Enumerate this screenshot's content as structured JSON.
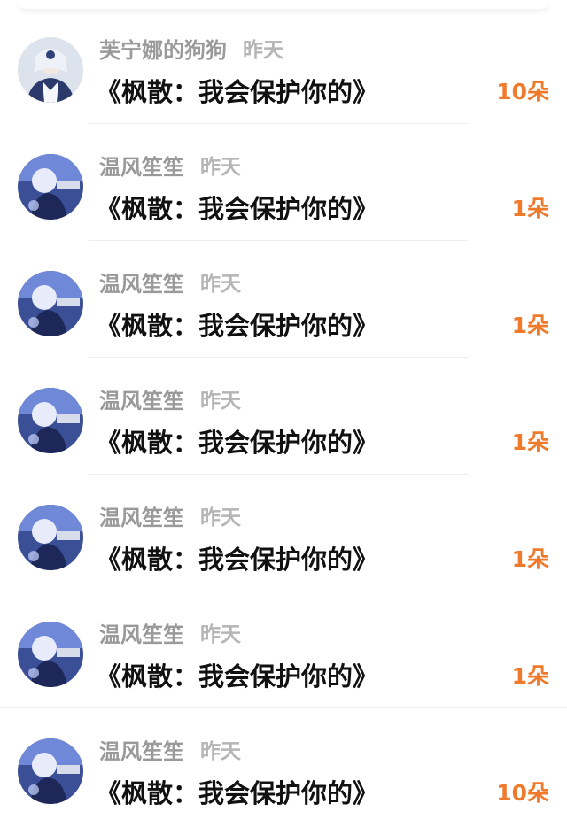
{
  "gifts": [
    {
      "username": "芙宁娜的狗狗",
      "time": "昨天",
      "gift": "《枫散：我会保护你的》",
      "count": "10朵",
      "avatar": "furina-avatar"
    },
    {
      "username": "温风笙笙",
      "time": "昨天",
      "gift": "《枫散：我会保护你的》",
      "count": "1朵",
      "avatar": "anime-avatar"
    },
    {
      "username": "温风笙笙",
      "time": "昨天",
      "gift": "《枫散：我会保护你的》",
      "count": "1朵",
      "avatar": "anime-avatar"
    },
    {
      "username": "温风笙笙",
      "time": "昨天",
      "gift": "《枫散：我会保护你的》",
      "count": "1朵",
      "avatar": "anime-avatar"
    },
    {
      "username": "温风笙笙",
      "time": "昨天",
      "gift": "《枫散：我会保护你的》",
      "count": "1朵",
      "avatar": "anime-avatar"
    },
    {
      "username": "温风笙笙",
      "time": "昨天",
      "gift": "《枫散：我会保护你的》",
      "count": "1朵",
      "avatar": "anime-avatar"
    },
    {
      "username": "温风笙笙",
      "time": "昨天",
      "gift": "《枫散：我会保护你的》",
      "count": "10朵",
      "avatar": "anime-avatar"
    }
  ],
  "colors": {
    "count": "#f07a2c",
    "username": "#9a9a9a",
    "time": "#b5b5b5",
    "gift": "#111111"
  }
}
